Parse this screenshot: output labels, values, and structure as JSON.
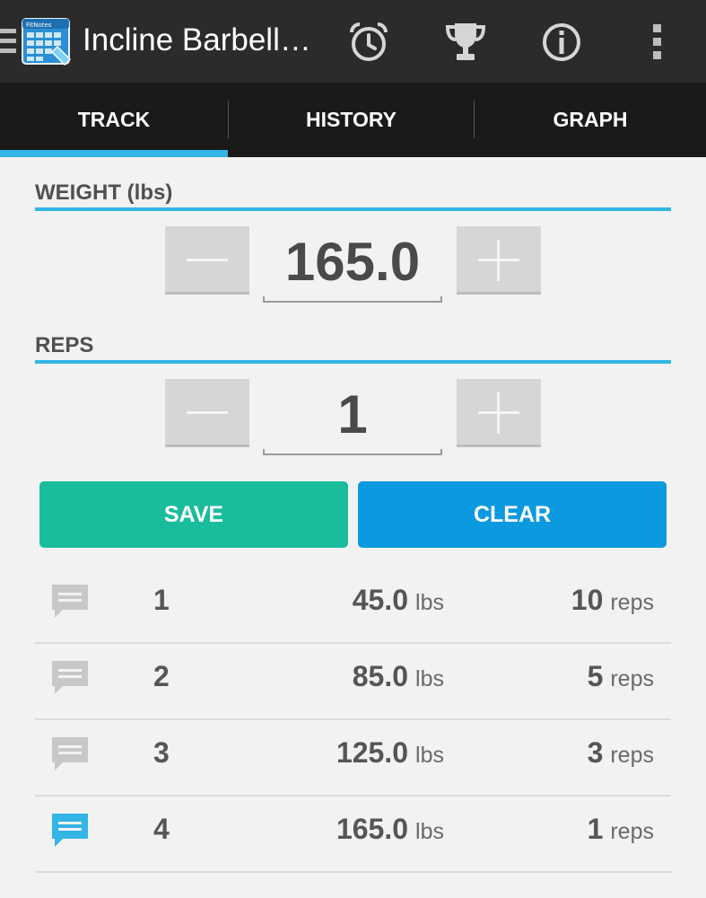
{
  "actionbar": {
    "title": "Incline Barbell…",
    "icons": [
      "menu-drawer-icon",
      "app-calendar-icon",
      "alarm-clock-icon",
      "trophy-icon",
      "info-icon",
      "overflow-menu-icon"
    ],
    "app_icon_text": "FitNotes"
  },
  "tabs": [
    {
      "label": "TRACK",
      "selected": true
    },
    {
      "label": "HISTORY",
      "selected": false
    },
    {
      "label": "GRAPH",
      "selected": false
    }
  ],
  "weight": {
    "label": "WEIGHT (lbs)",
    "value": "165.0"
  },
  "reps": {
    "label": "REPS",
    "value": "1"
  },
  "buttons": {
    "save": "SAVE",
    "clear": "CLEAR"
  },
  "sets": [
    {
      "num": "1",
      "weight": "45.0",
      "weight_unit": "lbs",
      "reps": "10",
      "reps_unit": "reps",
      "has_note": false
    },
    {
      "num": "2",
      "weight": "85.0",
      "weight_unit": "lbs",
      "reps": "5",
      "reps_unit": "reps",
      "has_note": false
    },
    {
      "num": "3",
      "weight": "125.0",
      "weight_unit": "lbs",
      "reps": "3",
      "reps_unit": "reps",
      "has_note": false
    },
    {
      "num": "4",
      "weight": "165.0",
      "weight_unit": "lbs",
      "reps": "1",
      "reps_unit": "reps",
      "has_note": true
    }
  ],
  "colors": {
    "accent": "#33b5e5",
    "save": "#1abc9c",
    "clear": "#0b99e0",
    "note_active": "#33b5e5",
    "note_inactive": "#c8c8c8"
  }
}
